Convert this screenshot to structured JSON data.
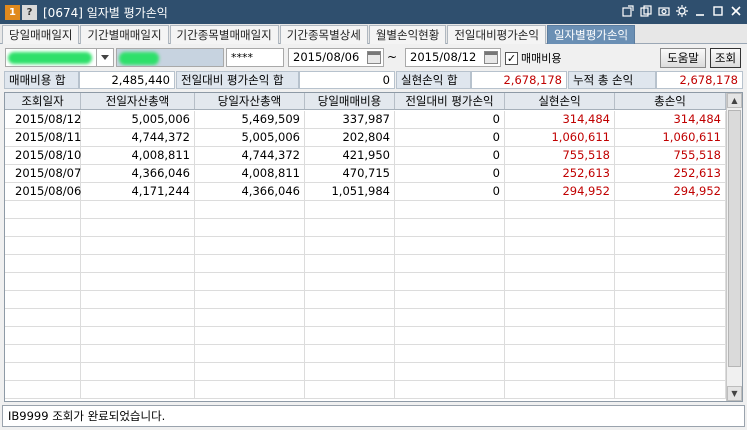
{
  "window": {
    "badge_num": "1",
    "badge_help": "?",
    "title": "[0674] 일자별 평가손익"
  },
  "tabs": [
    {
      "label": "당일매매일지"
    },
    {
      "label": "기간별매매일지"
    },
    {
      "label": "기간종목별매매일지"
    },
    {
      "label": "기간종목별상세"
    },
    {
      "label": "월별손익현황"
    },
    {
      "label": "전일대비평가손익"
    },
    {
      "label": "일자별평가손익"
    }
  ],
  "toolbar": {
    "password": "****",
    "date_from": "2015/08/06",
    "tilde": "~",
    "date_to": "2015/08/12",
    "fee_checkbox_label": "매매비용",
    "help_button": "도움말",
    "query_button": "조회"
  },
  "summary": {
    "fee_label": "매매비용 합",
    "fee_value": "2,485,440",
    "prev_label": "전일대비 평가손익 합",
    "prev_value": "0",
    "realized_label": "실현손익 합",
    "realized_value": "2,678,178",
    "cum_label": "누적 총 손익",
    "cum_value": "2,678,178"
  },
  "table": {
    "headers": [
      "조회일자",
      "전일자산총액",
      "당일자산총액",
      "당일매매비용",
      "전일대비 평가손익",
      "실현손익",
      "총손익"
    ],
    "rows": [
      [
        "2015/08/12",
        "5,005,006",
        "5,469,509",
        "337,987",
        "0",
        "314,484",
        "314,484"
      ],
      [
        "2015/08/11",
        "4,744,372",
        "5,005,006",
        "202,804",
        "0",
        "1,060,611",
        "1,060,611"
      ],
      [
        "2015/08/10",
        "4,008,811",
        "4,744,372",
        "421,950",
        "0",
        "755,518",
        "755,518"
      ],
      [
        "2015/08/07",
        "4,366,046",
        "4,008,811",
        "470,715",
        "0",
        "252,613",
        "252,613"
      ],
      [
        "2015/08/06",
        "4,171,244",
        "4,366,046",
        "1,051,984",
        "0",
        "294,952",
        "294,952"
      ]
    ]
  },
  "status": {
    "message": "IB9999  조회가 완료되었습니다."
  },
  "colors": {
    "profit": "#c00000",
    "active_tab": "#6a8fb4",
    "titlebar": "#2f4f6e"
  }
}
